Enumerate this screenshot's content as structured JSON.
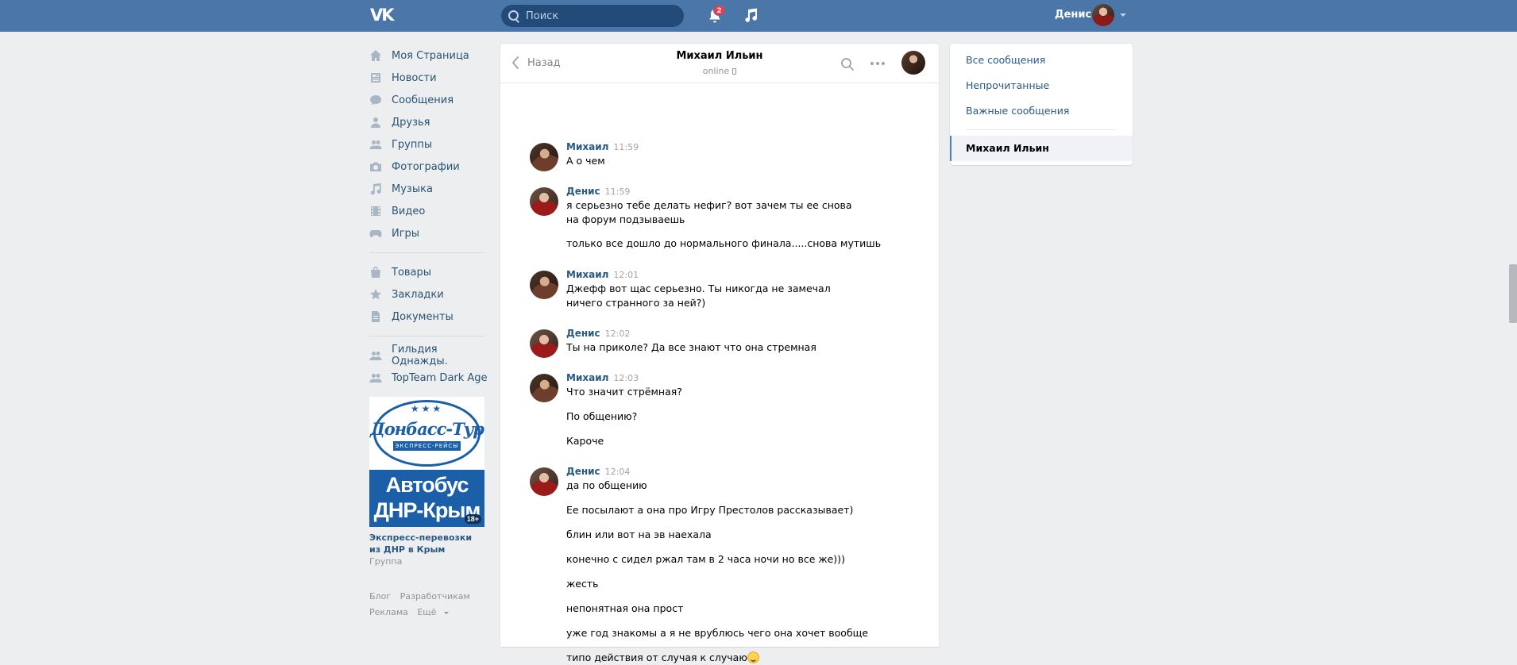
{
  "header": {
    "logo": "VK",
    "search_placeholder": "Поиск",
    "notifications_count": "2",
    "user_name": "Денис"
  },
  "sidebar": {
    "items": [
      {
        "label": "Моя Страница",
        "icon": "home-icon"
      },
      {
        "label": "Новости",
        "icon": "news-icon"
      },
      {
        "label": "Сообщения",
        "icon": "messages-icon"
      },
      {
        "label": "Друзья",
        "icon": "friends-icon"
      },
      {
        "label": "Группы",
        "icon": "groups-icon"
      },
      {
        "label": "Фотографии",
        "icon": "camera-icon"
      },
      {
        "label": "Музыка",
        "icon": "music-icon"
      },
      {
        "label": "Видео",
        "icon": "video-icon"
      },
      {
        "label": "Игры",
        "icon": "gamepad-icon"
      }
    ],
    "items2": [
      {
        "label": "Товары",
        "icon": "bag-icon"
      },
      {
        "label": "Закладки",
        "icon": "star-icon"
      },
      {
        "label": "Документы",
        "icon": "document-icon"
      }
    ],
    "items3": [
      {
        "label": "Гильдия Однажды.",
        "icon": "group-icon"
      },
      {
        "label": "TopTeam Dark Age",
        "icon": "group-icon"
      }
    ],
    "ad": {
      "logo_text": "Донбасс-Тур",
      "ribbon": "ЭКСПРЕСС-РЕЙСЫ",
      "line1": "Автобус",
      "line2": "ДНР-Крым",
      "age": "18+",
      "title": "Экспресс-перевозки из ДНР в Крым",
      "subtitle": "Группа"
    },
    "footer": {
      "blog": "Блог",
      "developers": "Разработчикам",
      "ads": "Реклама",
      "more": "Ещё"
    }
  },
  "chat": {
    "back_label": "Назад",
    "peer_name": "Михаил Ильин",
    "peer_status": "online",
    "groups": [
      {
        "author": "Михаил",
        "time": "11:59",
        "avatar": "m",
        "texts": [
          "А о чем"
        ]
      },
      {
        "author": "Денис",
        "time": "11:59",
        "avatar": "d",
        "texts": [
          "я серьезно тебе делать нефиг? вот зачем ты ее снова на форум подзываешь",
          "только все дошло до нормального финала.....снова мутишь"
        ]
      },
      {
        "author": "Михаил",
        "time": "12:01",
        "avatar": "m",
        "texts": [
          "Джефф вот щас серьезно. Ты никогда не замечал ничего странного за ней?)"
        ]
      },
      {
        "author": "Денис",
        "time": "12:02",
        "avatar": "d",
        "texts": [
          "Ты на приколе? Да все знают что она стремная"
        ]
      },
      {
        "author": "Михаил",
        "time": "12:03",
        "avatar": "m",
        "texts": [
          "Что значит стрёмная?",
          "По общению?",
          "Кароче"
        ]
      },
      {
        "author": "Денис",
        "time": "12:04",
        "avatar": "d",
        "texts": [
          "да по общению",
          "Ее посылают а она про Игру Престолов рассказывает)",
          "блин или вот на эв наехала",
          "конечно с сидел ржал там в 2 часа ночи но все же)))",
          "жесть",
          "непонятная она прост",
          "уже год знакомы а я не врублюсь чего она хочет вообще",
          "типо действия от случая к случаю"
        ]
      }
    ]
  },
  "right_panel": {
    "all_messages": "Все сообщения",
    "unread": "Непрочитанные",
    "important": "Важные сообщения",
    "active_chat": "Михаил Ильин"
  }
}
